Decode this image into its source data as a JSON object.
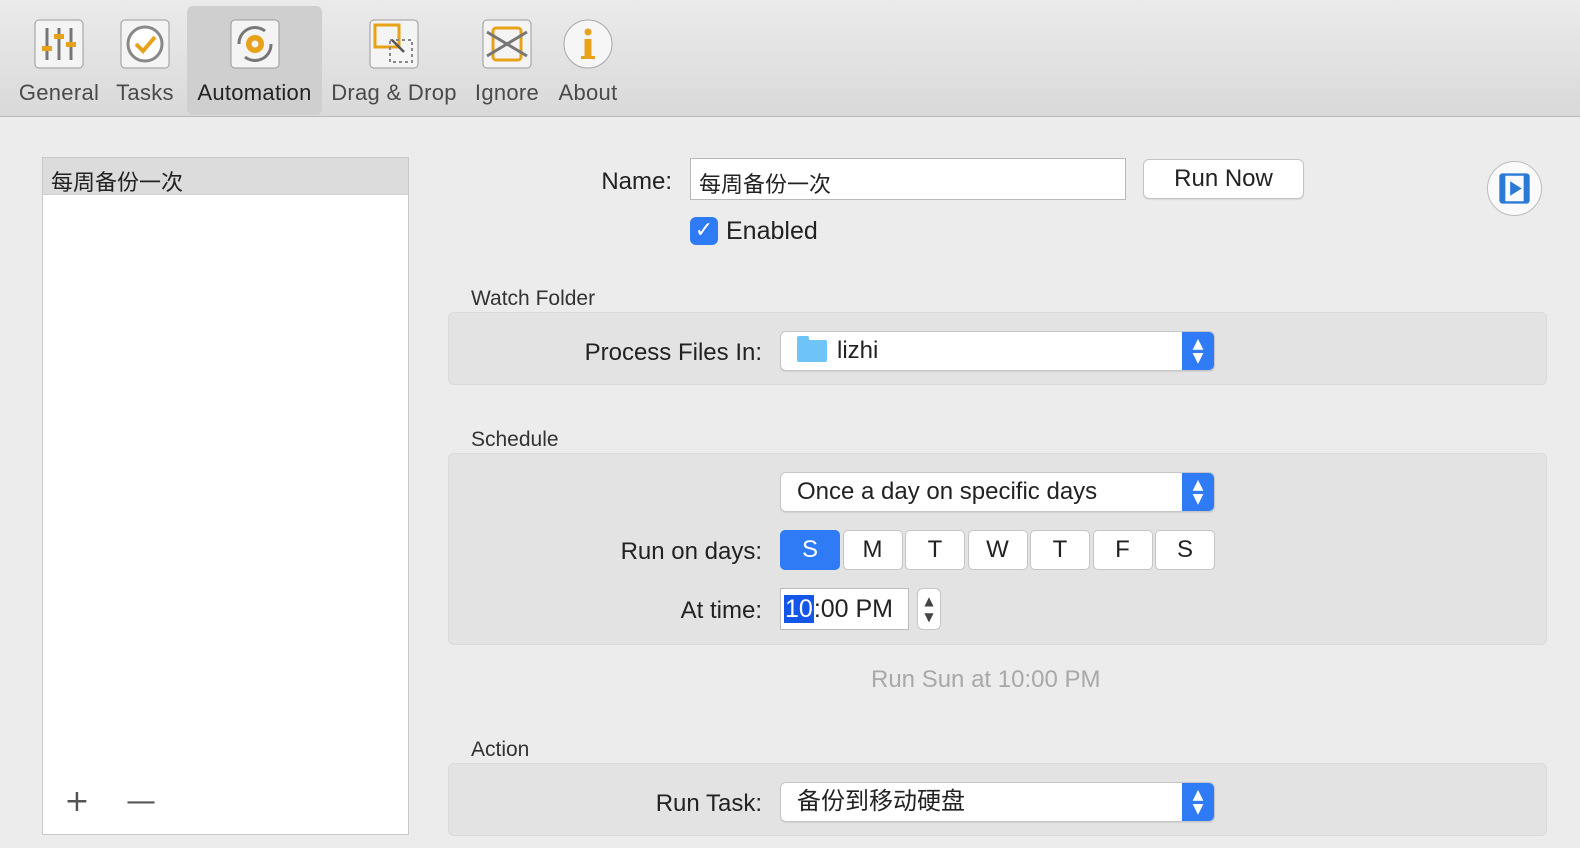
{
  "toolbar": {
    "items": [
      {
        "label": "General",
        "icon": "sliders-icon"
      },
      {
        "label": "Tasks",
        "icon": "checkmark-circle-icon"
      },
      {
        "label": "Automation",
        "icon": "gear-cycle-icon",
        "active": true
      },
      {
        "label": "Drag & Drop",
        "icon": "drag-drop-icon"
      },
      {
        "label": "Ignore",
        "icon": "ignore-icon"
      },
      {
        "label": "About",
        "icon": "info-icon"
      }
    ]
  },
  "sidebar": {
    "items": [
      {
        "label": "每周备份一次",
        "selected": true
      }
    ],
    "add_symbol": "+",
    "remove_symbol": "—"
  },
  "form": {
    "name_label": "Name:",
    "name_value": "每周备份一次",
    "run_now_label": "Run Now",
    "enabled_label": "Enabled",
    "enabled_checked": true,
    "watch_folder": {
      "title": "Watch Folder",
      "process_label": "Process Files In:",
      "folder_value": "lizhi"
    },
    "schedule": {
      "title": "Schedule",
      "frequency_value": "Once a day on specific days",
      "run_days_label": "Run on days:",
      "days": [
        {
          "label": "S",
          "selected": true
        },
        {
          "label": "M",
          "selected": false
        },
        {
          "label": "T",
          "selected": false
        },
        {
          "label": "W",
          "selected": false
        },
        {
          "label": "T",
          "selected": false
        },
        {
          "label": "F",
          "selected": false
        },
        {
          "label": "S",
          "selected": false
        }
      ],
      "time_label": "At time:",
      "time_hour": "10",
      "time_rest": ":00 PM",
      "summary": "Run Sun at 10:00 PM"
    },
    "action": {
      "title": "Action",
      "run_task_label": "Run Task:",
      "task_value": "备份到移动硬盘"
    }
  },
  "colors": {
    "accent": "#2f7bf5",
    "selection": "#1456e8",
    "icon_orange": "#e8a21a"
  }
}
